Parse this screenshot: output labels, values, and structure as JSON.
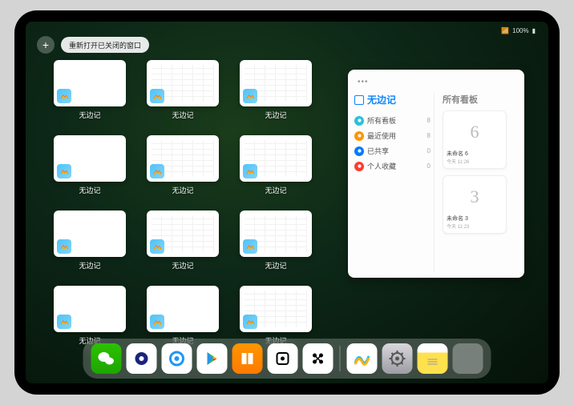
{
  "status": {
    "battery": "100%",
    "signal": "•••"
  },
  "top": {
    "add_label": "+",
    "reopen_label": "重新打开已关闭的窗口"
  },
  "app_name": "无边记",
  "window_tiles": [
    {
      "label": "无边记",
      "style": "blank"
    },
    {
      "label": "无边记",
      "style": "board"
    },
    {
      "label": "无边记",
      "style": "board"
    },
    null,
    {
      "label": "无边记",
      "style": "blank"
    },
    {
      "label": "无边记",
      "style": "board"
    },
    {
      "label": "无边记",
      "style": "board"
    },
    null,
    {
      "label": "无边记",
      "style": "blank"
    },
    {
      "label": "无边记",
      "style": "board"
    },
    {
      "label": "无边记",
      "style": "board"
    },
    null,
    {
      "label": "无边记",
      "style": "blank"
    },
    {
      "label": "无边记",
      "style": "blank"
    },
    {
      "label": "无边记",
      "style": "board"
    }
  ],
  "panel": {
    "title": "无边记",
    "nav": [
      {
        "label": "所有看板",
        "count": 8,
        "color": "cyan"
      },
      {
        "label": "最近使用",
        "count": 8,
        "color": "orange"
      },
      {
        "label": "已共享",
        "count": 0,
        "color": "blue"
      },
      {
        "label": "个人收藏",
        "count": 0,
        "color": "red"
      }
    ],
    "boards_title": "所有看板",
    "boards": [
      {
        "name": "未命名 6",
        "date": "今天 11:26",
        "sketch": "6"
      },
      {
        "name": "未命名 3",
        "date": "今天 11:23",
        "sketch": "3"
      }
    ]
  },
  "dock": {
    "items": [
      {
        "name": "wechat"
      },
      {
        "name": "browser-q-dark"
      },
      {
        "name": "browser-q-light"
      },
      {
        "name": "play-store"
      },
      {
        "name": "books"
      },
      {
        "name": "dice-app"
      },
      {
        "name": "barcode-app"
      }
    ],
    "recent": [
      {
        "name": "freeform"
      },
      {
        "name": "settings"
      },
      {
        "name": "notes"
      },
      {
        "name": "app-library-folder"
      }
    ]
  }
}
